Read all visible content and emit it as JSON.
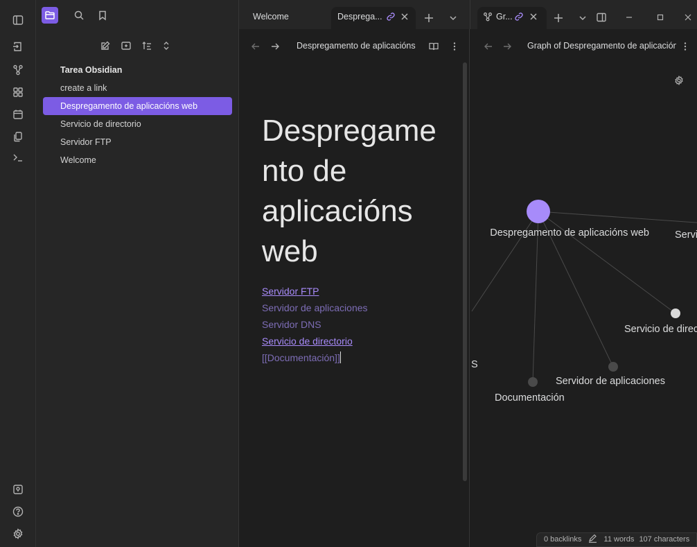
{
  "sidebar": {
    "folder": "Tarea Obsidian",
    "items": [
      {
        "label": "create a link"
      },
      {
        "label": "Despregamento de aplicacións web",
        "active": true
      },
      {
        "label": "Servicio de directorio"
      },
      {
        "label": "Servidor FTP"
      },
      {
        "label": "Welcome"
      }
    ]
  },
  "tabs": {
    "welcome": "Welcome",
    "note": "Desprega...",
    "graph": "Gr..."
  },
  "editor": {
    "header_title": "Despregamento de aplicacións web",
    "title": "Despregamento de aplicacións web",
    "title_lines": [
      "Despregame",
      "nto de",
      "aplicacións",
      "web"
    ],
    "links": [
      {
        "text": "Servidor FTP",
        "state": "resolved"
      },
      {
        "text": "Servidor de aplicaciones",
        "state": "unresolved"
      },
      {
        "text": "Servidor DNS",
        "state": "unresolved"
      },
      {
        "text": "Servicio de directorio",
        "state": "resolved"
      },
      {
        "text": "[[Documentación]]",
        "state": "raw"
      }
    ]
  },
  "graph": {
    "header_title": "Graph of Despregamento de aplicacións web",
    "labels": {
      "main": "Despregamento de aplicacións web",
      "servidor_ftp": "Servidor FTP",
      "servicio_dir": "Servicio de directorio",
      "servidor_apps": "Servidor de aplicaciones",
      "documentacion": "Documentación",
      "dns_fragment": "S"
    }
  },
  "status": {
    "backlinks": "0 backlinks",
    "words": "11 words",
    "characters": "107 characters"
  },
  "colors": {
    "accent": "#7c5ce4",
    "link": "#a88bfa",
    "node_main": "#a78bfa",
    "node_resolved": "#d9d9d9",
    "node_unresolved": "#4a4a4a"
  }
}
